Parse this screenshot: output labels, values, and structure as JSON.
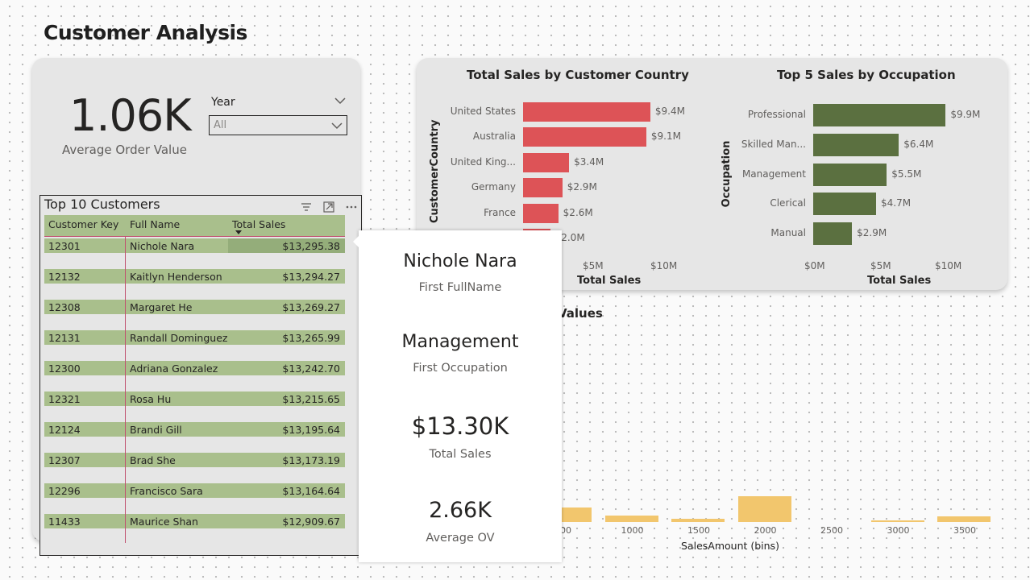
{
  "page": {
    "title": "Customer Analysis"
  },
  "kpi": {
    "value": "1.06K",
    "label": "Average Order Value"
  },
  "slicer": {
    "label": "Year",
    "selected": "All"
  },
  "table": {
    "title": "Top 10 Customers",
    "columns": [
      "Customer Key",
      "Full Name",
      "Total Sales"
    ],
    "rows": [
      [
        "12301",
        "Nichole Nara",
        "$13,295.38"
      ],
      [
        "12132",
        "Kaitlyn Henderson",
        "$13,294.27"
      ],
      [
        "12308",
        "Margaret He",
        "$13,269.27"
      ],
      [
        "12131",
        "Randall Dominguez",
        "$13,265.99"
      ],
      [
        "12300",
        "Adriana Gonzalez",
        "$13,242.70"
      ],
      [
        "12321",
        "Rosa Hu",
        "$13,215.65"
      ],
      [
        "12124",
        "Brandi Gill",
        "$13,195.64"
      ],
      [
        "12307",
        "Brad She",
        "$13,173.19"
      ],
      [
        "12296",
        "Francisco Sara",
        "$13,164.64"
      ],
      [
        "11433",
        "Maurice Shan",
        "$12,909.67"
      ]
    ]
  },
  "tooltip": {
    "name_value": "Nichole Nara",
    "name_label": "First FullName",
    "occupation_value": "Management",
    "occupation_label": "First Occupation",
    "sales_value": "$13.30K",
    "sales_label": "Total Sales",
    "aov_value": "2.66K",
    "aov_label": "Average OV"
  },
  "histogram_title_partial": "Values",
  "chart_data": [
    {
      "type": "bar",
      "orientation": "horizontal",
      "title": "Total Sales by Customer Country",
      "xlabel": "Total Sales",
      "ylabel": "CustomerCountry",
      "categories": [
        "United States",
        "Australia",
        "United King...",
        "Germany",
        "France",
        ""
      ],
      "values": [
        9.4,
        9.1,
        3.4,
        2.9,
        2.6,
        2.0
      ],
      "value_labels": [
        "$9.4M",
        "$9.1M",
        "$3.4M",
        "$2.9M",
        "$2.6M",
        "$2.0M"
      ],
      "xticks": [
        "$5M",
        "$10M"
      ],
      "xlim": [
        0,
        11.5
      ],
      "color": "#dd5357"
    },
    {
      "type": "bar",
      "orientation": "horizontal",
      "title": "Top 5 Sales by Occupation",
      "xlabel": "Total Sales",
      "ylabel": "Occupation",
      "categories": [
        "Professional",
        "Skilled Man...",
        "Management",
        "Clerical",
        "Manual"
      ],
      "values": [
        9.9,
        6.4,
        5.5,
        4.7,
        2.9
      ],
      "value_labels": [
        "$9.9M",
        "$6.4M",
        "$5.5M",
        "$4.7M",
        "$2.9M"
      ],
      "xticks": [
        "$0M",
        "$5M",
        "$10M"
      ],
      "xlim": [
        0,
        11.5
      ],
      "color": "#5b7040"
    },
    {
      "type": "bar",
      "title": "",
      "xlabel": "SalesAmount (bins)",
      "ylabel": "",
      "x": [
        500,
        1000,
        1500,
        2000,
        2500,
        3000,
        3500
      ],
      "values": [
        18,
        8,
        4,
        32,
        0,
        2,
        7
      ],
      "xticks": [
        "500",
        "1000",
        "1500",
        "2000",
        "2500",
        "3000",
        "3500"
      ],
      "color": "#f2c66d"
    }
  ]
}
